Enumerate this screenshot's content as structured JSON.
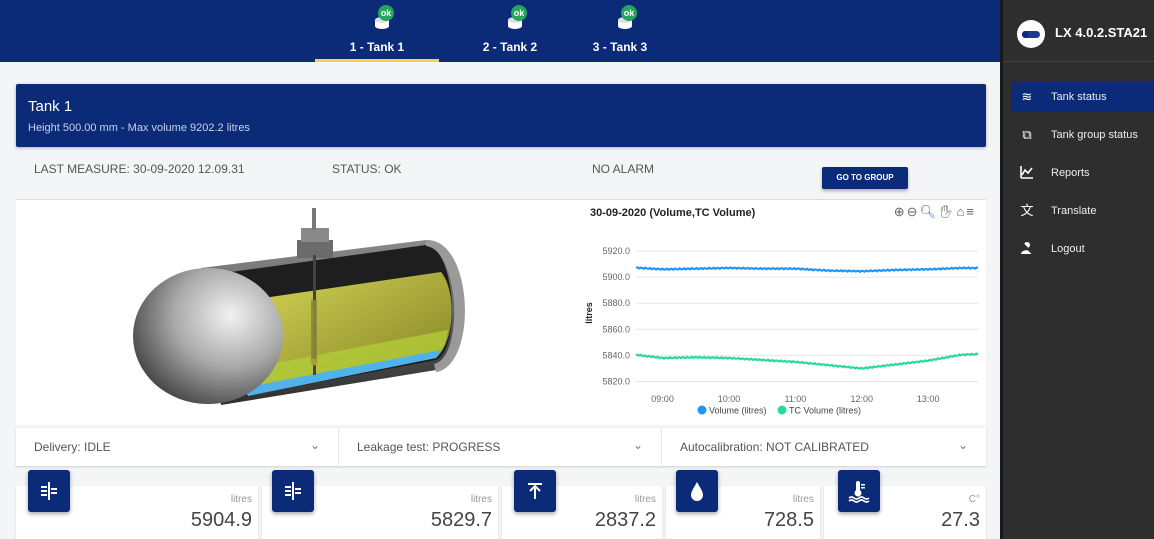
{
  "tabs": [
    {
      "label": "1 - Tank 1",
      "badge": "ok",
      "active": true
    },
    {
      "label": "2 - Tank 2",
      "badge": "ok",
      "active": false
    },
    {
      "label": "3 - Tank 3",
      "badge": "ok",
      "active": false
    }
  ],
  "header": {
    "title": "Tank 1",
    "subtitle": "Height 500.00 mm - Max volume 9202.2 litres"
  },
  "info": {
    "last_measure": "LAST MEASURE: 30-09-2020 12.09.31",
    "status": "STATUS: OK",
    "alarm": "NO ALARM",
    "go_group": "GO TO GROUP"
  },
  "chart_data": {
    "type": "line",
    "title": "30-09-2020 (Volume,TC Volume)",
    "ylabel": "litres",
    "xlabel": "",
    "x_ticks": [
      "09:00",
      "10:00",
      "11:00",
      "12:00",
      "13:00"
    ],
    "y_ticks": [
      "5920.0",
      "5900.0",
      "5880.0",
      "5860.0",
      "5840.0",
      "5820.0"
    ],
    "ylim": [
      5815,
      5930
    ],
    "x_hours": [
      8.5,
      9.0,
      9.5,
      10.0,
      10.5,
      11.0,
      11.5,
      12.0,
      12.5,
      13.0,
      13.5,
      13.75
    ],
    "series": [
      {
        "name": "Volume (litres)",
        "color": "#2196f3",
        "values": [
          5907.5,
          5906.0,
          5906.5,
          5907.0,
          5906.5,
          5906.5,
          5905.0,
          5904.5,
          5905.5,
          5906.0,
          5907.0,
          5907.0
        ]
      },
      {
        "name": "TC Volume (litres)",
        "color": "#2bd9a0",
        "values": [
          5841.0,
          5838.0,
          5838.5,
          5838.0,
          5836.5,
          5835.0,
          5832.5,
          5830.0,
          5833.0,
          5836.0,
          5840.5,
          5841.0
        ]
      }
    ],
    "grid": true,
    "legend": "bottom",
    "tools": [
      "zoom-in",
      "zoom-out",
      "magnify",
      "pan",
      "home",
      "menu"
    ]
  },
  "statusbar": {
    "delivery": "Delivery: IDLE",
    "leakage": "Leakage test: PROGRESS",
    "autocal": "Autocalibration: NOT CALIBRATED"
  },
  "metrics": [
    {
      "icon": "level-gauge-icon",
      "unit": "litres",
      "value": "5904.9"
    },
    {
      "icon": "level-gauge-icon",
      "unit": "litres",
      "value": "5829.7"
    },
    {
      "icon": "ullage-icon",
      "unit": "litres",
      "value": "2837.2"
    },
    {
      "icon": "water-drop-icon",
      "unit": "litres",
      "value": "728.5"
    },
    {
      "icon": "thermometer-water-icon",
      "unit": "C°",
      "value": "27.3"
    }
  ],
  "sidebar": {
    "title": "LX 4.0.2.STA21",
    "items": [
      {
        "label": "Tank status",
        "icon": "waves-icon",
        "active": true
      },
      {
        "label": "Tank group status",
        "icon": "group-icon",
        "active": false
      },
      {
        "label": "Reports",
        "icon": "chart-icon",
        "active": false
      },
      {
        "label": "Translate",
        "icon": "translate-icon",
        "active": false
      },
      {
        "label": "Logout",
        "icon": "logout-icon",
        "active": false
      }
    ]
  },
  "colors": {
    "brand": "#0b2a78",
    "accent": "#f1d24a",
    "ok": "#26a65b",
    "sidebar": "#2e2e2e"
  }
}
